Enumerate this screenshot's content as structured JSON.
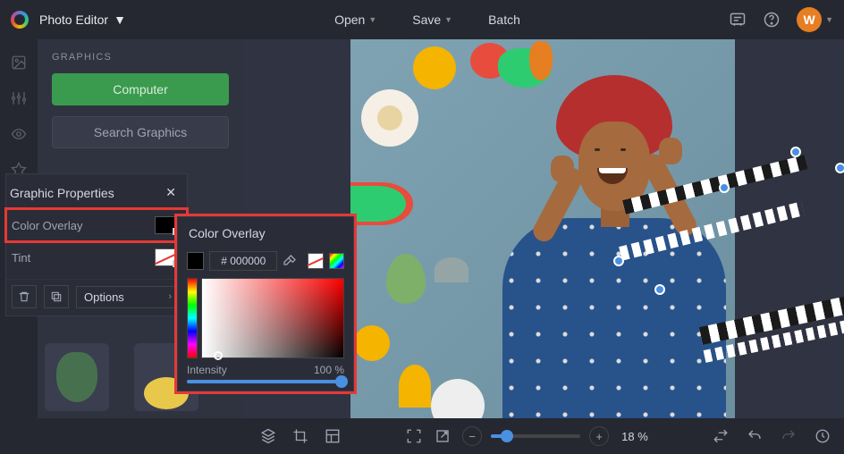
{
  "header": {
    "app_title": "Photo Editor",
    "open": "Open",
    "save": "Save",
    "batch": "Batch",
    "avatar_initial": "W"
  },
  "side_panel": {
    "section_title": "GRAPHICS",
    "computer_btn": "Computer",
    "search_btn": "Search Graphics"
  },
  "graphic_properties": {
    "title": "Graphic Properties",
    "color_overlay_label": "Color Overlay",
    "tint_label": "Tint",
    "options_label": "Options"
  },
  "color_overlay_popover": {
    "title": "Color Overlay",
    "hex_value": "# 000000",
    "intensity_label": "Intensity",
    "intensity_value": "100 %"
  },
  "bottom": {
    "zoom_label": "18 %",
    "zoom_pct": 18
  }
}
